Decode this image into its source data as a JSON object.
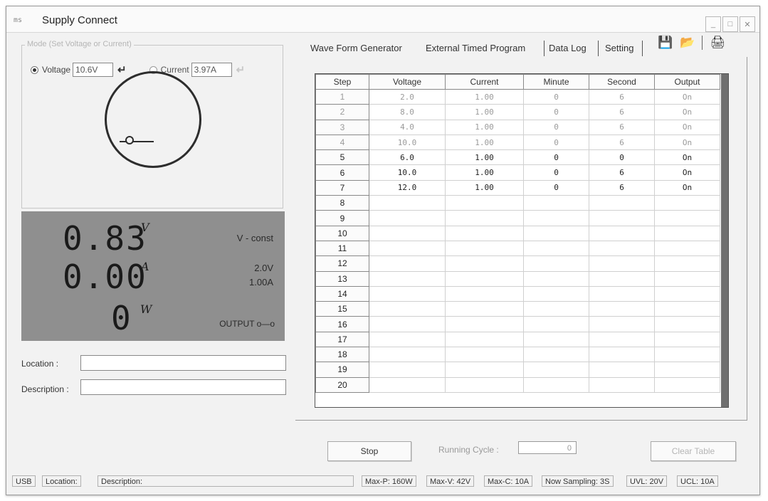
{
  "window": {
    "icon": "ms",
    "title": "Supply Connect",
    "controls": [
      "_",
      "□",
      "✕"
    ]
  },
  "mode": {
    "legend": "Mode (Set Voltage or Current)",
    "voltage_label": "Voltage",
    "voltage_value": "10.6V",
    "voltage_selected": true,
    "current_label": "Current",
    "current_value": "3.97A",
    "current_selected": false,
    "enter_glyph": "↵"
  },
  "display": {
    "voltage": "0.83",
    "current": "0.00",
    "power": "0",
    "unit_v": "V",
    "unit_a": "A",
    "unit_w": "W",
    "mode": "V - const",
    "set_voltage": "2.0V",
    "set_current": "1.00A",
    "output": "OUTPUT o—o"
  },
  "fields": {
    "location_label": "Location :",
    "description_label": "Description :"
  },
  "tabs": [
    {
      "label": "Wave Form Generator",
      "active": false
    },
    {
      "label": "External Timed Program",
      "active": true
    },
    {
      "label": "Data Log",
      "active": false
    },
    {
      "label": "Setting",
      "active": false
    }
  ],
  "toolbar_icons": [
    "save-icon",
    "open-icon",
    "print-icon"
  ],
  "program": {
    "headers": [
      "Step",
      "Voltage",
      "Current",
      "Minute",
      "Second",
      "Output"
    ],
    "rows": [
      {
        "step": "1",
        "voltage": "2.0",
        "current": "1.00",
        "minute": "0",
        "second": "6",
        "output": "On"
      },
      {
        "step": "2",
        "voltage": "8.0",
        "current": "1.00",
        "minute": "0",
        "second": "6",
        "output": "On"
      },
      {
        "step": "3",
        "voltage": "4.0",
        "current": "1.00",
        "minute": "0",
        "second": "6",
        "output": "On"
      },
      {
        "step": "4",
        "voltage": "10.0",
        "current": "1.00",
        "minute": "0",
        "second": "6",
        "output": "On"
      },
      {
        "step": "5",
        "voltage": "6.0",
        "current": "1.00",
        "minute": "0",
        "second": "0",
        "output": "On"
      },
      {
        "step": "6",
        "voltage": "10.0",
        "current": "1.00",
        "minute": "0",
        "second": "6",
        "output": "On"
      },
      {
        "step": "7",
        "voltage": "12.0",
        "current": "1.00",
        "minute": "0",
        "second": "6",
        "output": "On"
      },
      {
        "step": "8"
      },
      {
        "step": "9"
      },
      {
        "step": "10"
      },
      {
        "step": "11"
      },
      {
        "step": "12"
      },
      {
        "step": "13"
      },
      {
        "step": "14"
      },
      {
        "step": "15"
      },
      {
        "step": "16"
      },
      {
        "step": "17"
      },
      {
        "step": "18"
      },
      {
        "step": "19"
      },
      {
        "step": "20"
      }
    ]
  },
  "controls": {
    "stop_label": "Stop",
    "running_cycle_label": "Running Cycle :",
    "running_cycle_value": "0",
    "clear_table_label": "Clear Table"
  },
  "statusbar": {
    "interface": "USB",
    "location": "Location:",
    "description": "Description:",
    "max_p": "Max-P: 160W",
    "max_v": "Max-V: 42V",
    "max_c": "Max-C: 10A",
    "sampling": "Now Sampling: 3S",
    "uvl": "UVL: 20V",
    "ucl": "UCL: 10A"
  }
}
